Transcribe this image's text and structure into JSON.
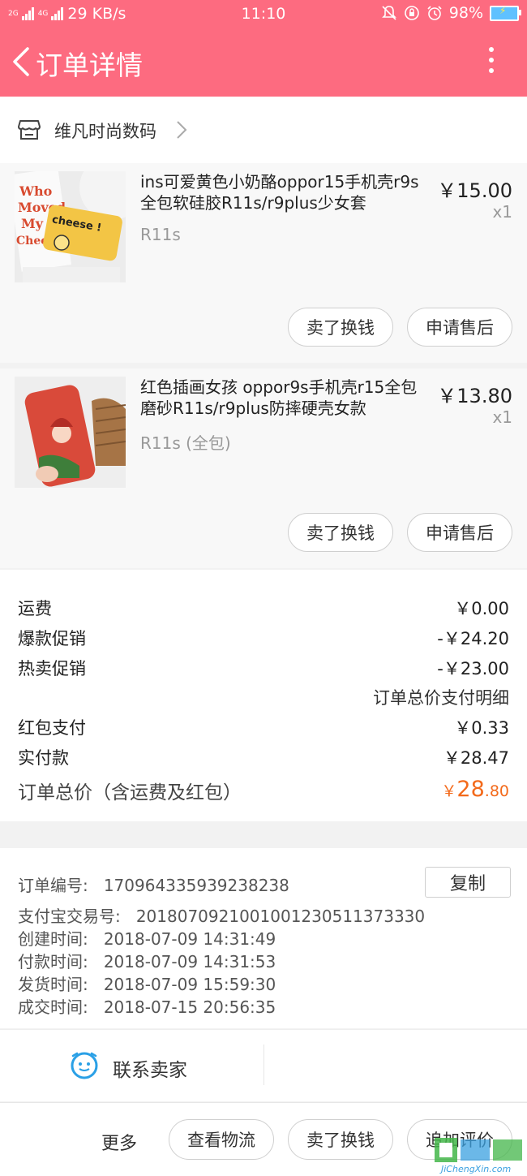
{
  "status_bar": {
    "signal_1": "2G",
    "signal_2": "4G",
    "speed": "29 KB/s",
    "time": "11:10",
    "battery": "98%"
  },
  "header": {
    "title": "订单详情"
  },
  "shop": {
    "name": "维凡时尚数码"
  },
  "items": [
    {
      "title": "ins可爱黄色小奶酪oppor15手机壳r9s全包软硅胶R11s/r9plus少女套",
      "spec": "R11s",
      "price": "￥15.00",
      "qty": "x1",
      "button_resell": "卖了换钱",
      "button_aftersale": "申请售后",
      "thumb_text_1": "Who",
      "thumb_text_2": "Moved",
      "thumb_text_3": "My",
      "thumb_text_4": "Cheese",
      "thumb_text_5": "cheese !"
    },
    {
      "title": "红色插画女孩 oppor9s手机壳r15全包磨砂R11s/r9plus防摔硬壳女款",
      "spec": "R11s (全包)",
      "price": "￥13.80",
      "qty": "x1",
      "button_resell": "卖了换钱",
      "button_aftersale": "申请售后"
    }
  ],
  "summary": {
    "shipping_label": "运费",
    "shipping_value": "￥0.00",
    "promo1_label": "爆款促销",
    "promo1_value": "-￥24.20",
    "promo2_label": "热卖促销",
    "promo2_value": "-￥23.00",
    "detail_link": "订单总价支付明细",
    "redpacket_label": "红包支付",
    "redpacket_value": "￥0.33",
    "paid_label": "实付款",
    "paid_value": "￥28.47",
    "total_label": "订单总价（含运费及红包）",
    "total_currency": "￥",
    "total_int": "28",
    "total_dec": ".80"
  },
  "order_info": {
    "order_no_label": "订单编号:",
    "order_no": "170964335939238238",
    "copy_label": "复制",
    "alipay_label": "支付宝交易号:",
    "alipay_no": "2018070921001001230511373330",
    "created_label": "创建时间:",
    "created": "2018-07-09 14:31:49",
    "paid_label": "付款时间:",
    "paid": "2018-07-09 14:31:53",
    "shipped_label": "发货时间:",
    "shipped": "2018-07-09 15:59:30",
    "closed_label": "成交时间:",
    "closed": "2018-07-15 20:56:35"
  },
  "contact": {
    "label": "联系卖家"
  },
  "bottom_bar": {
    "more": "更多",
    "logistics": "查看物流",
    "resell": "卖了换钱",
    "review": "追加评价"
  },
  "watermark": {
    "text": "JiChengXin.com"
  },
  "colors": {
    "brand": "#fd6b80",
    "price_accent": "#f36a1b"
  }
}
